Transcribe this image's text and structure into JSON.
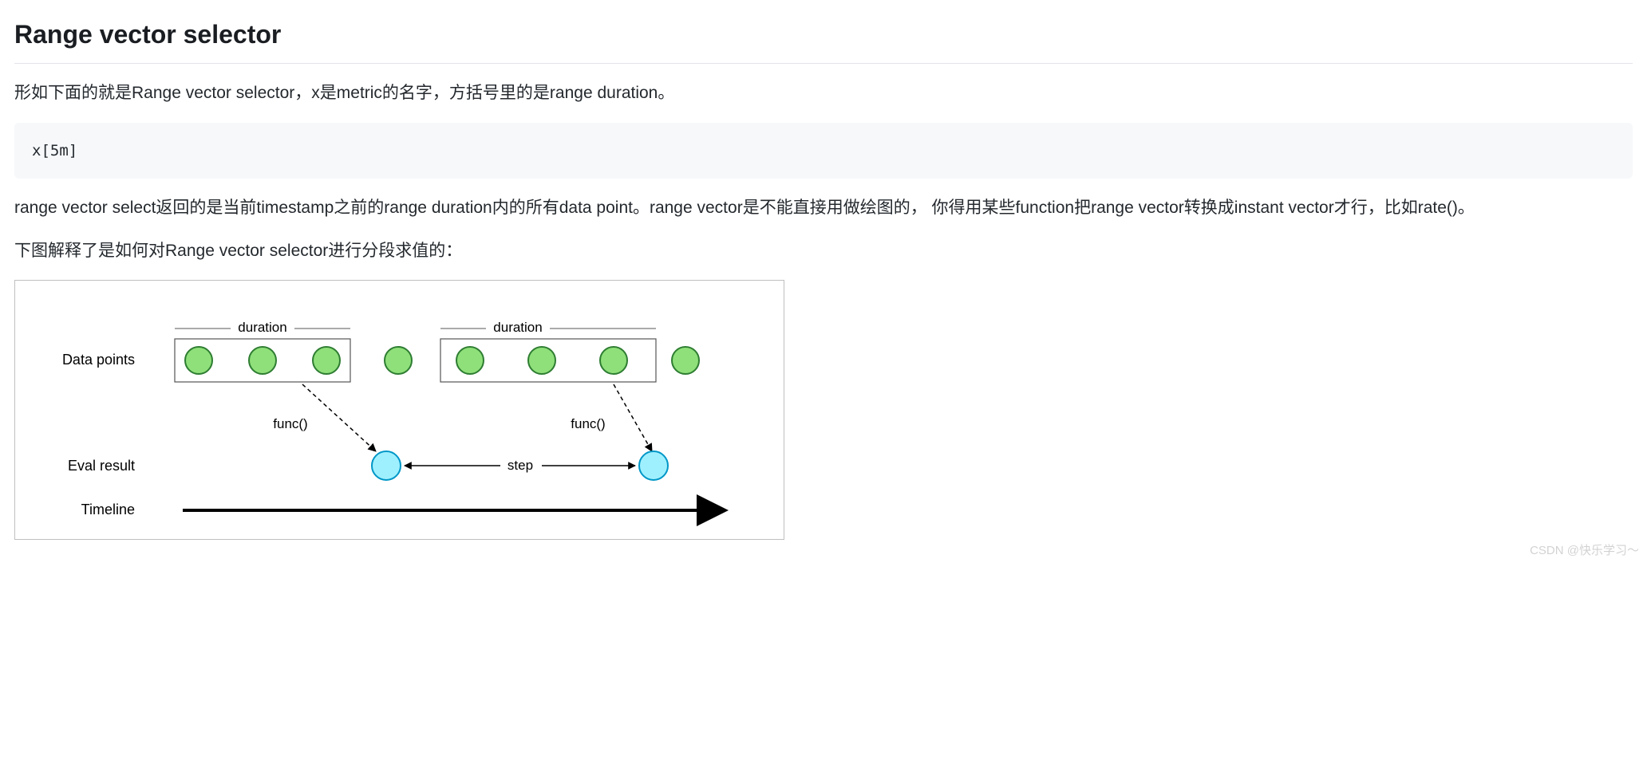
{
  "heading": "Range vector selector",
  "para1": "形如下面的就是Range vector selector，x是metric的名字，方括号里的是range duration。",
  "code": "x[5m]",
  "para2": "range vector select返回的是当前timestamp之前的range duration内的所有data point。range vector是不能直接用做绘图的，  你得用某些function把range vector转换成instant vector才行，比如rate()。",
  "para3": "下图解释了是如何对Range vector selector进行分段求值的：",
  "diagram": {
    "duration_label_1": "duration",
    "duration_label_2": "duration",
    "row_data_points": "Data points",
    "row_eval_result": "Eval result",
    "row_timeline": "Timeline",
    "func_label_1": "func()",
    "func_label_2": "func()",
    "step_label": "step"
  },
  "watermark": "CSDN @快乐学习～"
}
